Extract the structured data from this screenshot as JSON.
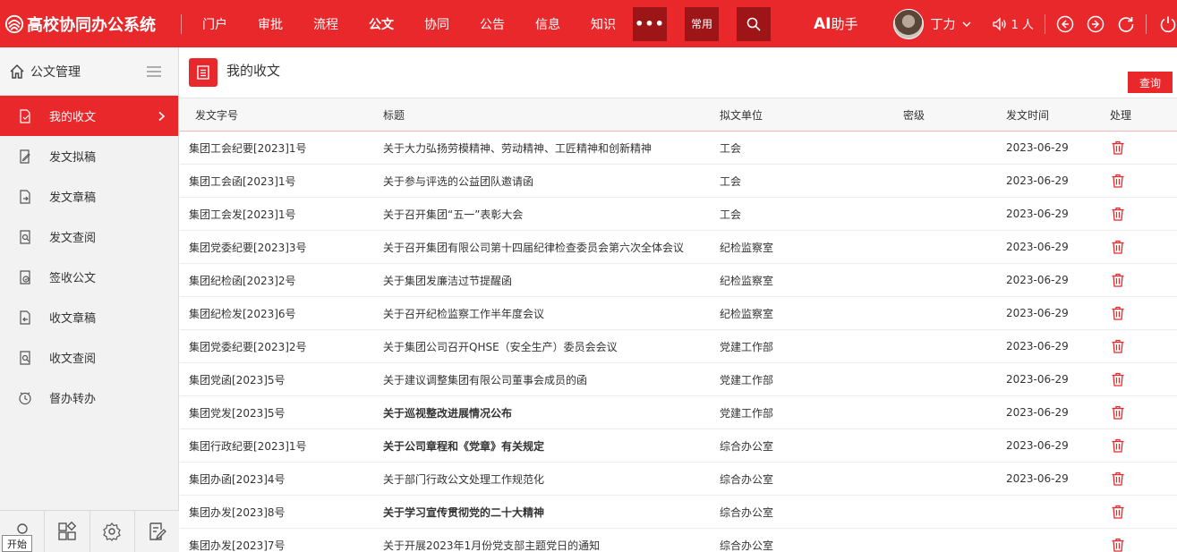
{
  "app": {
    "title": "高校协同办公系统"
  },
  "nav": [
    {
      "label": "门户",
      "active": false
    },
    {
      "label": "审批",
      "active": false
    },
    {
      "label": "流程",
      "active": false
    },
    {
      "label": "公文",
      "active": true
    },
    {
      "label": "协同",
      "active": false
    },
    {
      "label": "公告",
      "active": false
    },
    {
      "label": "信息",
      "active": false
    },
    {
      "label": "知识",
      "active": false
    }
  ],
  "header": {
    "more": "•••",
    "common": "常用",
    "ai_prefix": "AI",
    "ai_suffix": "助手",
    "user": "丁力",
    "online": "1 人"
  },
  "sidebar": {
    "title": "公文管理",
    "items": [
      {
        "label": "我的收文",
        "active": true,
        "icon": "receive-doc-icon"
      },
      {
        "label": "发文拟稿",
        "active": false,
        "icon": "draft-edit-icon"
      },
      {
        "label": "发文章稿",
        "active": false,
        "icon": "send-doc-icon"
      },
      {
        "label": "发文查阅",
        "active": false,
        "icon": "doc-search-icon"
      },
      {
        "label": "签收公文",
        "active": false,
        "icon": "sign-doc-icon"
      },
      {
        "label": "收文章稿",
        "active": false,
        "icon": "receive-draft-icon"
      },
      {
        "label": "收文查阅",
        "active": false,
        "icon": "receive-search-icon"
      },
      {
        "label": "督办转办",
        "active": false,
        "icon": "clock-icon"
      }
    ],
    "start_tip": "开始"
  },
  "main": {
    "title": "我的收文",
    "query_button": "查询",
    "columns": [
      "发文字号",
      "标题",
      "拟文单位",
      "密级",
      "发文时间",
      "处理"
    ],
    "rows": [
      {
        "no": "集团工会纪要[2023]1号",
        "title": "关于大力弘扬劳模精神、劳动精神、工匠精神和创新精神",
        "unit": "工会",
        "level": "",
        "date": "2023-06-29",
        "bold": false
      },
      {
        "no": "集团工会函[2023]1号",
        "title": "关于参与评选的公益团队邀请函",
        "unit": "工会",
        "level": "",
        "date": "2023-06-29",
        "bold": false
      },
      {
        "no": "集团工会发[2023]1号",
        "title": "关于召开集团“五一”表彰大会",
        "unit": "工会",
        "level": "",
        "date": "2023-06-29",
        "bold": false
      },
      {
        "no": "集团党委纪要[2023]3号",
        "title": "关于召开集团有限公司第十四届纪律检查委员会第六次全体会议",
        "unit": "纪检监察室",
        "level": "",
        "date": "2023-06-29",
        "bold": false
      },
      {
        "no": "集团纪检函[2023]2号",
        "title": "关于集团发廉洁过节提醒函",
        "unit": "纪检监察室",
        "level": "",
        "date": "2023-06-29",
        "bold": false
      },
      {
        "no": "集团纪检发[2023]6号",
        "title": "关于召开纪检监察工作半年度会议",
        "unit": "纪检监察室",
        "level": "",
        "date": "2023-06-29",
        "bold": false
      },
      {
        "no": "集团党委纪要[2023]2号",
        "title": "关于集团公司召开QHSE（安全生产）委员会会议",
        "unit": "党建工作部",
        "level": "",
        "date": "2023-06-29",
        "bold": false
      },
      {
        "no": "集团党函[2023]5号",
        "title": "关于建议调整集团有限公司董事会成员的函",
        "unit": "党建工作部",
        "level": "",
        "date": "2023-06-29",
        "bold": false
      },
      {
        "no": "集团党发[2023]5号",
        "title": "关于巡视整改进展情况公布",
        "unit": "党建工作部",
        "level": "",
        "date": "2023-06-29",
        "bold": true
      },
      {
        "no": "集团行政纪要[2023]1号",
        "title": "关于公司章程和《党章》有关规定",
        "unit": "综合办公室",
        "level": "",
        "date": "2023-06-29",
        "bold": true
      },
      {
        "no": "集团办函[2023]4号",
        "title": "关于部门行政公文处理工作规范化",
        "unit": "综合办公室",
        "level": "",
        "date": "2023-06-29",
        "bold": false
      },
      {
        "no": "集团办发[2023]8号",
        "title": "关于学习宣传贯彻党的二十大精神",
        "unit": "综合办公室",
        "level": "",
        "date": "",
        "bold": true
      },
      {
        "no": "集团办发[2023]7号",
        "title": "关于开展2023年1月份党支部主题党日的通知",
        "unit": "综合办公室",
        "level": "",
        "date": "",
        "bold": false
      }
    ]
  },
  "colors": {
    "brand": "#e8282b",
    "brand_dark": "#9e1518",
    "sidebar_bg": "#f2f2f2"
  }
}
